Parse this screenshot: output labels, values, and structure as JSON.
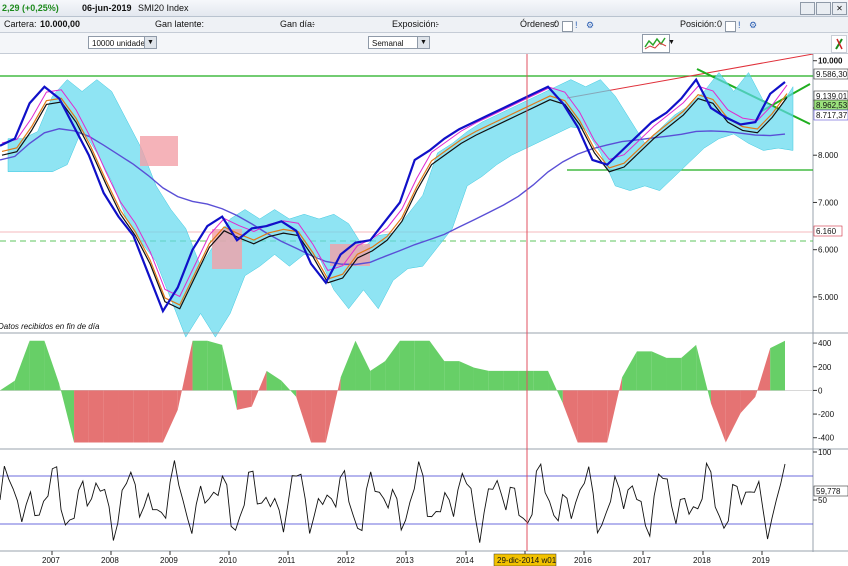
{
  "header": {
    "change_text": "2,29 (+0,25%)",
    "date": "06-jun-2019",
    "instrument": "SMI20 Index"
  },
  "portfolio": {
    "cartera_label": "Cartera:",
    "cartera_value": "10.000,00",
    "gan_latente_label": "Gan latente:",
    "gan_latente_value": "-",
    "gan_dia_label": "Gan día:",
    "gan_dia_value": "-",
    "exposicion_label": "Exposición:",
    "exposicion_value": "-",
    "ordenes_label": "Órdenes:",
    "ordenes_value": "0",
    "posicion_label": "Posición:",
    "posicion_value": "0"
  },
  "controls": {
    "quantity_select": "10000 unidades",
    "period_select": "Semanal"
  },
  "status_text": "Datos recibidos en fin de día",
  "price_labels": {
    "right_box_1": "9.586,30",
    "right_box_2": "9.139,01",
    "right_box_3": "8.962,53",
    "right_box_4": "8.717,37",
    "right_box_5": "6.160",
    "right_box_6": "59,778"
  },
  "cursor_date_label": "29-dic-2014 w01",
  "colors": {
    "price": "#1010c8",
    "ma_slow": "#5a4fd6",
    "cloud_up": "#5fd8ee",
    "cloud_down": "#f3a0a8",
    "green_line": "#1fae1f",
    "red_line": "#e0303a",
    "osc_up": "#4cc74c",
    "osc_down": "#e05a5a"
  },
  "chart_data": [
    {
      "type": "line",
      "title": "",
      "x": [
        "2007",
        "2008",
        "2009",
        "2010",
        "2011",
        "2012",
        "2013",
        "2014",
        "2015",
        "2016",
        "2017",
        "2018",
        "2019"
      ],
      "yticks": [
        10000,
        9000,
        8000,
        7000,
        6000,
        5000
      ],
      "ylim": [
        4300,
        10100
      ],
      "series": [
        {
          "values": [
            8200,
            8350,
            9100,
            9450,
            9200,
            8600,
            8000,
            7200,
            6700,
            6300,
            5500,
            4700,
            5200,
            6000,
            6500,
            6700,
            6200,
            6450,
            6500,
            6600,
            6400,
            5700,
            5300,
            5900,
            6150,
            6200,
            6600,
            7000,
            7900,
            8100,
            8350,
            8550,
            8700,
            8850,
            9000,
            9150,
            9300,
            9450,
            9100,
            8600,
            7900,
            7800,
            8100,
            8400,
            8700,
            8900,
            9200,
            9600,
            9000,
            8800,
            8650,
            8700,
            9300,
            9550
          ]
        }
      ]
    },
    {
      "type": "area",
      "title": "",
      "yticks": [
        400,
        200,
        0,
        -200,
        -400
      ],
      "ylim": [
        -470,
        460
      ]
    },
    {
      "type": "line",
      "title": "",
      "yticks": [
        100,
        50
      ],
      "ylim": [
        0,
        100
      ],
      "reference_levels": [
        75,
        25
      ]
    }
  ]
}
